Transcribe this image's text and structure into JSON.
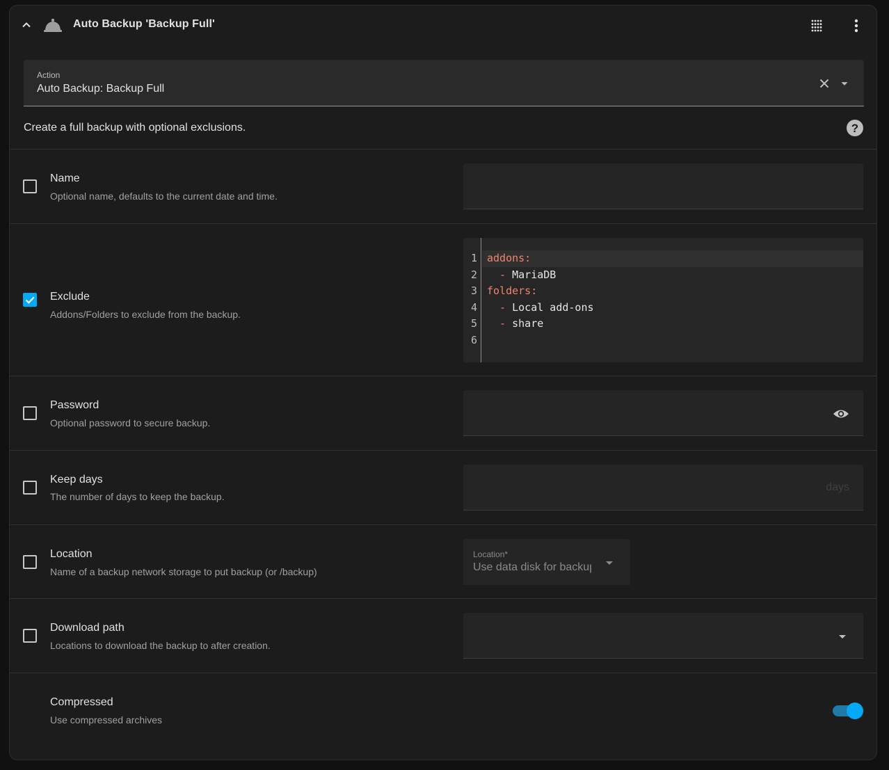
{
  "header": {
    "title": "Auto Backup 'Backup Full'",
    "icons": [
      "chevron-up-icon",
      "bell-icon",
      "drag-grid-icon",
      "more-vertical-icon"
    ]
  },
  "action": {
    "label": "Action",
    "value": "Auto Backup: Backup Full"
  },
  "description": "Create a full backup with optional exclusions.",
  "fields": {
    "name": {
      "label": "Name",
      "description": "Optional name, defaults to the current date and time.",
      "checked": false
    },
    "exclude": {
      "label": "Exclude",
      "description": "Addons/Folders to exclude from the backup.",
      "checked": true,
      "code": {
        "line_numbers": [
          "1",
          "2",
          "3",
          "4",
          "5",
          "6"
        ],
        "lines": [
          {
            "key": "addons:",
            "dash": "",
            "text": ""
          },
          {
            "key": "",
            "dash": "  - ",
            "text": "MariaDB"
          },
          {
            "key": "folders:",
            "dash": "",
            "text": ""
          },
          {
            "key": "",
            "dash": "  - ",
            "text": "Local add-ons"
          },
          {
            "key": "",
            "dash": "  - ",
            "text": "share"
          },
          {
            "key": "",
            "dash": "",
            "text": ""
          }
        ]
      }
    },
    "password": {
      "label": "Password",
      "description": "Optional password to secure backup.",
      "checked": false
    },
    "keep_days": {
      "label": "Keep days",
      "description": "The number of days to keep the backup.",
      "checked": false,
      "suffix": "days"
    },
    "location": {
      "label": "Location",
      "description": "Name of a backup network storage to put backup (or /backup)",
      "checked": false,
      "select_label": "Location*",
      "select_value": "Use data disk for backup"
    },
    "download_path": {
      "label": "Download path",
      "description": "Locations to download the backup to after creation.",
      "checked": false
    },
    "compressed": {
      "label": "Compressed",
      "description": "Use compressed archives",
      "enabled": true
    }
  },
  "colors": {
    "accent": "#03a9f4",
    "code_key": "#f0846c",
    "background": "#1c1c1c"
  }
}
